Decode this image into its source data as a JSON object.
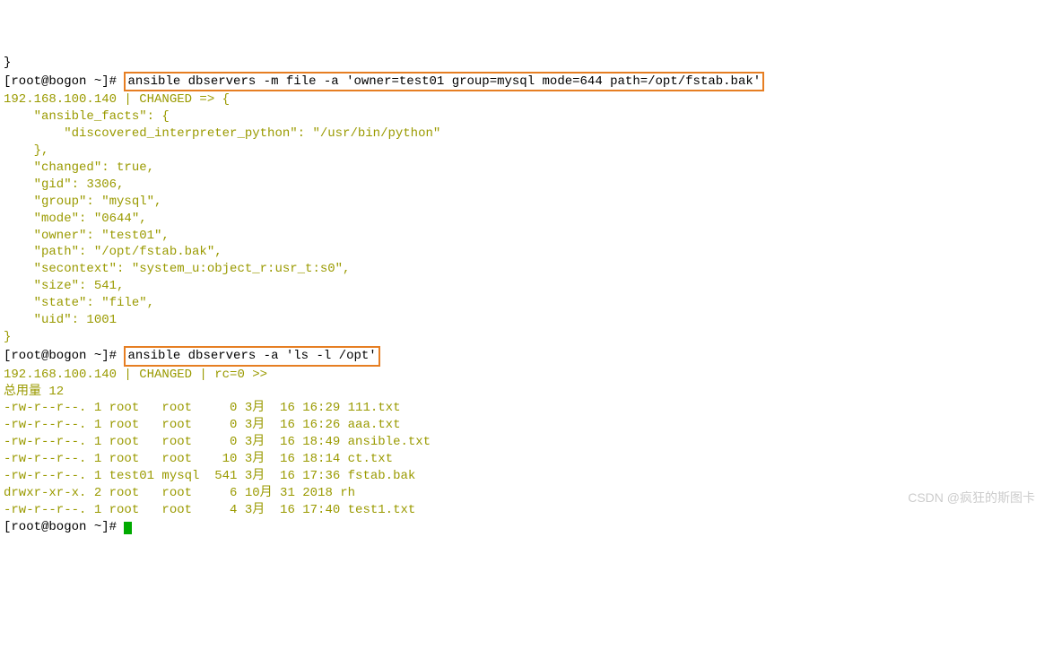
{
  "line_top": "}",
  "prompt1_prefix": "[root@bogon ~]#",
  "cmd1": "ansible dbservers -m file -a 'owner=test01 group=mysql mode=644 path=/opt/fstab.bak'",
  "json_output": {
    "header": "192.168.100.140 | CHANGED => {",
    "facts_open": "    \"ansible_facts\": {",
    "discovered": "        \"discovered_interpreter_python\": \"/usr/bin/python\"",
    "facts_close": "    },",
    "changed": "    \"changed\": true,",
    "gid": "    \"gid\": 3306,",
    "group": "    \"group\": \"mysql\",",
    "mode": "    \"mode\": \"0644\",",
    "owner": "    \"owner\": \"test01\",",
    "path": "    \"path\": \"/opt/fstab.bak\",",
    "secontext": "    \"secontext\": \"system_u:object_r:usr_t:s0\",",
    "size": "    \"size\": 541,",
    "state": "    \"state\": \"file\",",
    "uid": "    \"uid\": 1001",
    "close": "}"
  },
  "prompt2_prefix": "[root@bogon ~]#",
  "cmd2": "ansible dbservers -a 'ls -l /opt'",
  "ls_header": "192.168.100.140 | CHANGED | rc=0 >>",
  "total": "总用量 12",
  "files": [
    "-rw-r--r--. 1 root   root     0 3月  16 16:29 111.txt",
    "-rw-r--r--. 1 root   root     0 3月  16 16:26 aaa.txt",
    "-rw-r--r--. 1 root   root     0 3月  16 18:49 ansible.txt",
    "-rw-r--r--. 1 root   root    10 3月  16 18:14 ct.txt",
    "-rw-r--r--. 1 test01 mysql  541 3月  16 17:36 fstab.bak",
    "drwxr-xr-x. 2 root   root     6 10月 31 2018 rh",
    "-rw-r--r--. 1 root   root     4 3月  16 17:40 test1.txt"
  ],
  "prompt3_prefix": "[root@bogon ~]# ",
  "watermark": "CSDN @疯狂的斯图卡"
}
